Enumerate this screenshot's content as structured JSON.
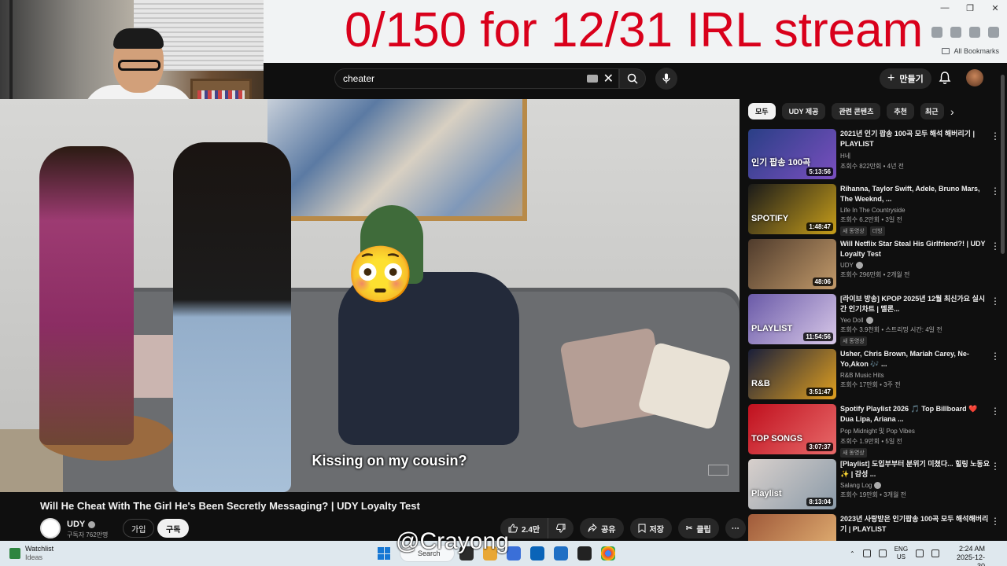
{
  "overlay": {
    "title": "0/150 for 12/31 IRL stream",
    "watermark": "@Crayong"
  },
  "browser": {
    "bookmarks_label": "All Bookmarks"
  },
  "header": {
    "search_value": "cheater",
    "create_label": "만들기"
  },
  "video": {
    "caption": "Kissing on my cousin?",
    "emoji": "😳",
    "title": "Will He Cheat With The Girl He's Been Secretly Messaging? | UDY Loyalty Test",
    "channel": "UDY",
    "subscribers": "구독자 762만명",
    "join_label": "가입",
    "subscribe_label": "구독",
    "likes": "2.4만",
    "share_label": "공유",
    "save_label": "저장",
    "clip_label": "클립"
  },
  "chips": [
    "모두",
    "UDY 제공",
    "관련 콘텐츠",
    "추천",
    "최근"
  ],
  "recommendations": [
    {
      "title": "2021년 인기 팝송 100곡 모두 해석 해버리기 | PLAYLIST",
      "channel": "H네",
      "meta": "조회수 822만회 • 4년 전",
      "duration": "5:13:56",
      "thumb_text": "인기 팝송 100곡",
      "thumb_colors": [
        "#2a3f86",
        "#7a4fbf"
      ],
      "verified": false,
      "badges": []
    },
    {
      "title": "Rihanna, Taylor Swift, Adele, Bruno Mars, The Weeknd, ...",
      "channel": "Life In The Countryside",
      "meta": "조회수 6.2만회 • 3일 전",
      "duration": "1:48:47",
      "thumb_text": "SPOTIFY",
      "thumb_colors": [
        "#1a1a1a",
        "#c79e1a"
      ],
      "verified": false,
      "badges": [
        "새 동영상",
        "더빙"
      ]
    },
    {
      "title": "Will Netflix Star Steal His Girlfriend?! | UDY Loyalty Test",
      "channel": "UDY",
      "meta": "조회수 296만회 • 2개월 전",
      "duration": "48:06",
      "thumb_text": "",
      "thumb_colors": [
        "#4f3b2c",
        "#c29a6a"
      ],
      "verified": true,
      "badges": []
    },
    {
      "title": "[라이브 방송] KPOP 2025년 12월 최신가요 실시간 인기차트 | 멜론...",
      "channel": "Yeo Doll",
      "meta": "조회수 3.9천회 • 스트리밍 시간: 4일 전",
      "duration": "11:54:56",
      "thumb_text": "PLAYLIST",
      "thumb_colors": [
        "#6a5aa8",
        "#d8c8e8"
      ],
      "verified": true,
      "badges": [
        "새 동영상"
      ]
    },
    {
      "title": "Usher, Chris Brown, Mariah Carey, Ne-Yo,Akon 🎶 ...",
      "channel": "R&B Music Hits",
      "meta": "조회수 17만회 • 3주 전",
      "duration": "3:51:47",
      "thumb_text": "R&B",
      "thumb_colors": [
        "#1a1f3a",
        "#e0a020"
      ],
      "verified": false,
      "badges": []
    },
    {
      "title": "Spotify Playlist 2026 🎵 Top Billboard ❤️ Dua Lipa, Ariana ...",
      "channel": "Pop Midnight 및 Pop Vibes",
      "meta": "조회수 1.9만회 • 5일 전",
      "duration": "3:07:37",
      "thumb_text": "TOP SONGS",
      "thumb_colors": [
        "#c0101e",
        "#e86a6a"
      ],
      "verified": false,
      "badges": [
        "새 동영상"
      ]
    },
    {
      "title": "[Playlist] 도입부부터 분위기 미쳤다... 힐링 노동요 ✨ | 감성 ...",
      "channel": "Salang Log",
      "meta": "조회수 19만회 • 3개월 전",
      "duration": "8:13:04",
      "thumb_text": "Playlist",
      "thumb_colors": [
        "#d8d0cc",
        "#8a9aa8"
      ],
      "verified": true,
      "badges": []
    },
    {
      "title": "2023년 사랑받은 인기팝송 100곡 모두 해석해버리기 | PLAYLIST",
      "channel": "",
      "meta": "",
      "duration": "",
      "thumb_text": "",
      "thumb_colors": [
        "#a05a3a",
        "#e8b878"
      ],
      "verified": false,
      "badges": []
    }
  ],
  "taskbar": {
    "weather_title": "Watchlist",
    "weather_sub": "Ideas",
    "search_label": "Search",
    "lang_1": "ENG",
    "lang_2": "US",
    "time": "2:24 AM",
    "date": "2025-12-30"
  }
}
